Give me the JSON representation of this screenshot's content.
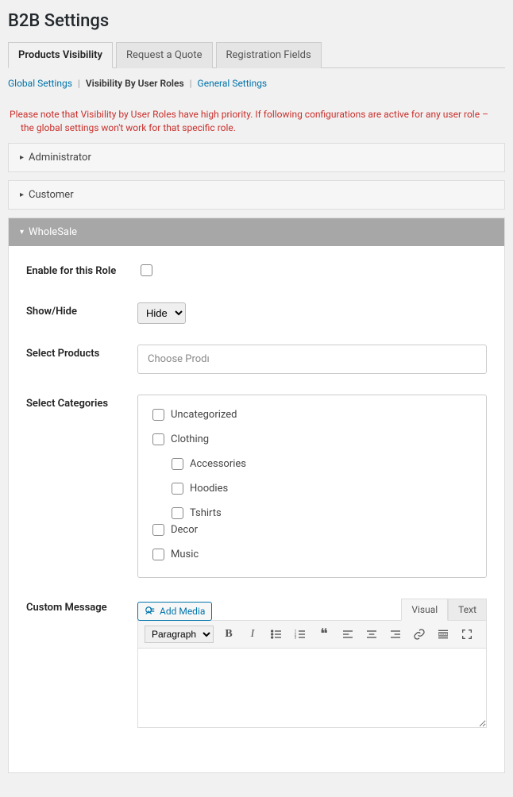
{
  "page_title": "B2B Settings",
  "top_tabs": {
    "t0": "Products Visibility",
    "t1": "Request a Quote",
    "t2": "Registration Fields"
  },
  "crumbs": {
    "c0": "Global Settings",
    "c1": "Visibility By User Roles",
    "c2": "General Settings",
    "sep": "|"
  },
  "notice": {
    "line1": "Please note that Visibility by User Roles have high priority. If following configurations are active for any user role –",
    "line2": "the global settings won't work for that specific role."
  },
  "roles": {
    "admin": "Administrator",
    "customer": "Customer",
    "wholesale": "WholeSale"
  },
  "form": {
    "enable_label": "Enable for this Role",
    "showhide_label": "Show/Hide",
    "showhide_value": "Hide",
    "select_products_label": "Select Products",
    "select_products_placeholder": "Choose Prodı",
    "select_categories_label": "Select Categories",
    "custom_message_label": "Custom Message"
  },
  "categories": {
    "uncat": "Uncategorized",
    "clothing": "Clothing",
    "accessories": "Accessories",
    "hoodies": "Hoodies",
    "tshirts": "Tshirts",
    "decor": "Decor",
    "music": "Music"
  },
  "editor": {
    "add_media": "Add Media",
    "tab_visual": "Visual",
    "tab_text": "Text",
    "format_select": "Paragraph"
  }
}
